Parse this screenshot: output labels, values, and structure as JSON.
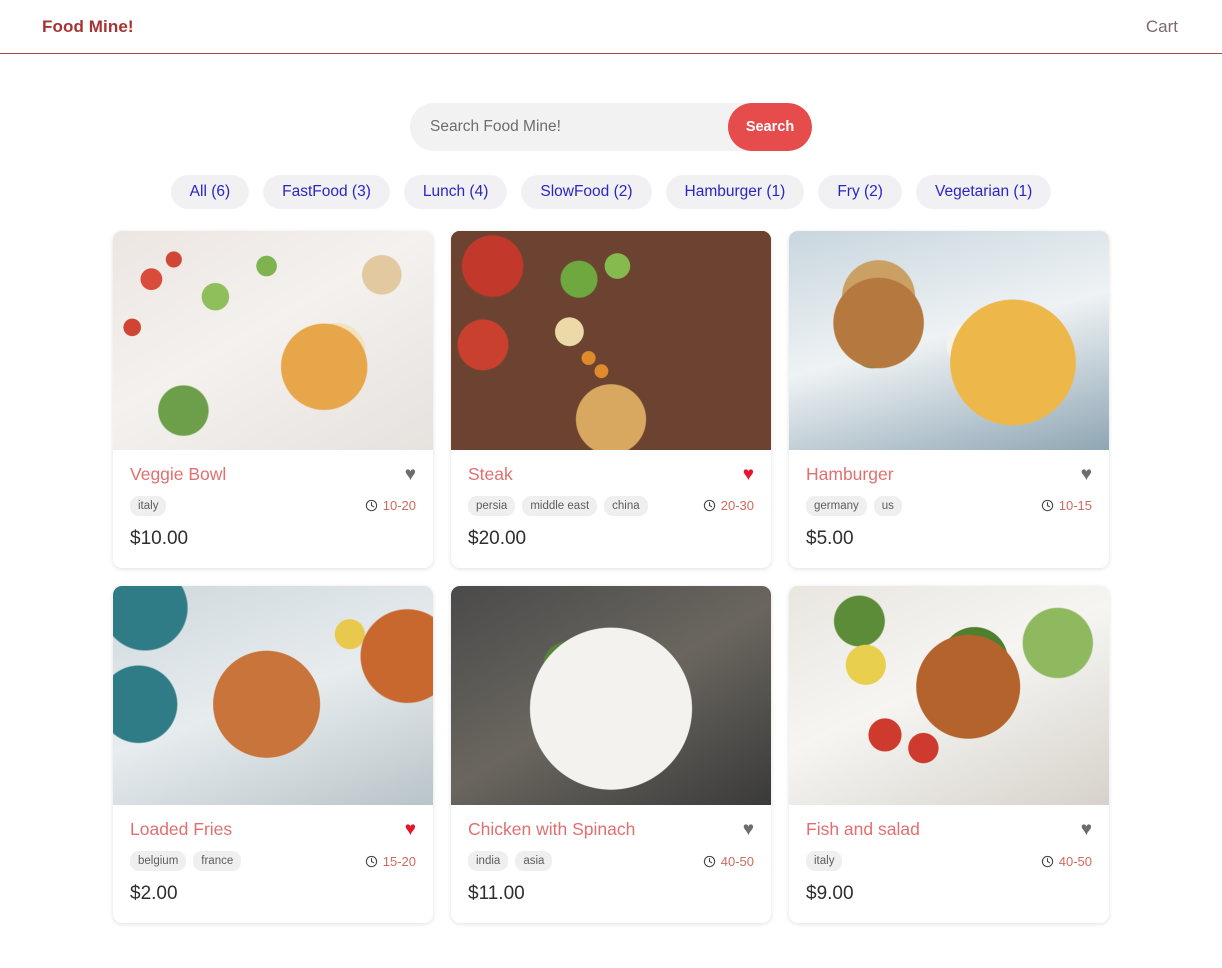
{
  "header": {
    "brand": "Food Mine!",
    "cart_label": "Cart",
    "brand_color": "#a83232",
    "border_color": "#a04a4a"
  },
  "search": {
    "placeholder": "Search Food Mine!",
    "value": "",
    "button_label": "Search",
    "button_color": "#e74c4c"
  },
  "chips": [
    {
      "label": "All (6)"
    },
    {
      "label": "FastFood (3)"
    },
    {
      "label": "Lunch (4)"
    },
    {
      "label": "SlowFood (2)"
    },
    {
      "label": "Hamburger (1)"
    },
    {
      "label": "Fry (2)"
    },
    {
      "label": "Vegetarian (1)"
    }
  ],
  "chip_text_color": "#2b25c4",
  "icons": {
    "heart": "♥",
    "clock": "clock-icon"
  },
  "foods": [
    {
      "name": "Veggie Bowl",
      "favorite": false,
      "tags": [
        "italy"
      ],
      "cook_time": "10-20",
      "price": "$10.00",
      "image_alt": "veggie-bowl-photo"
    },
    {
      "name": "Steak",
      "favorite": true,
      "tags": [
        "persia",
        "middle east",
        "china"
      ],
      "cook_time": "20-30",
      "price": "$20.00",
      "image_alt": "steak-photo"
    },
    {
      "name": "Hamburger",
      "favorite": false,
      "tags": [
        "germany",
        "us"
      ],
      "cook_time": "10-15",
      "price": "$5.00",
      "image_alt": "hamburger-photo"
    },
    {
      "name": "Loaded Fries",
      "favorite": true,
      "tags": [
        "belgium",
        "france"
      ],
      "cook_time": "15-20",
      "price": "$2.00",
      "image_alt": "loaded-fries-photo"
    },
    {
      "name": "Chicken with Spinach",
      "favorite": false,
      "tags": [
        "india",
        "asia"
      ],
      "cook_time": "40-50",
      "price": "$11.00",
      "image_alt": "chicken-with-spinach-photo"
    },
    {
      "name": "Fish and salad",
      "favorite": false,
      "tags": [
        "italy"
      ],
      "cook_time": "40-50",
      "price": "$9.00",
      "image_alt": "fish-and-salad-photo"
    }
  ]
}
